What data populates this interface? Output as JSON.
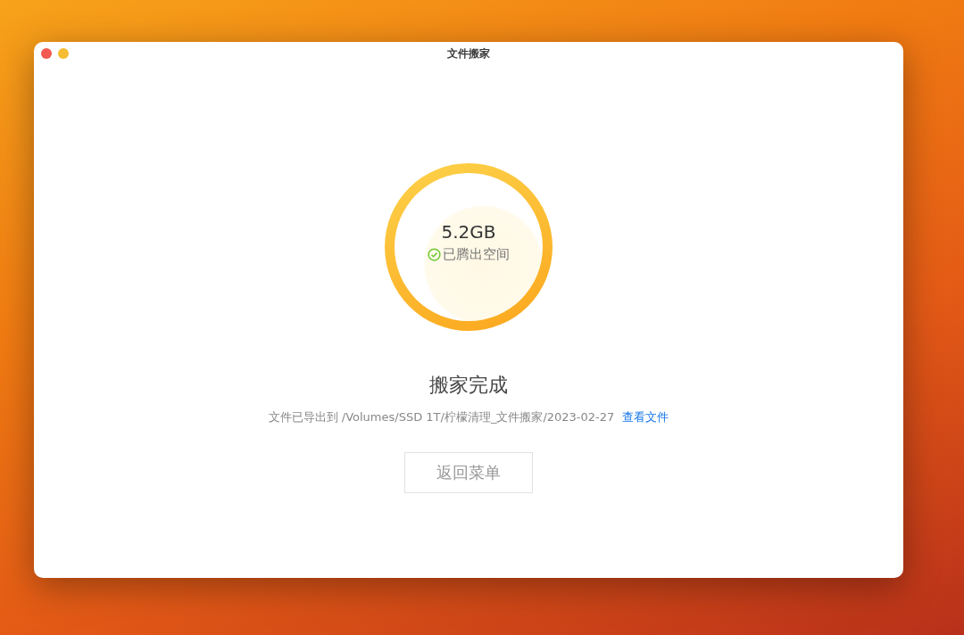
{
  "window": {
    "title": "文件搬家"
  },
  "ring": {
    "amount": "5.2GB",
    "status": "已腾出空间"
  },
  "result": {
    "heading": "搬家完成",
    "message": "文件已导出到 /Volumes/SSD 1T/柠檬清理_文件搬家/2023-02-27",
    "link": "查看文件"
  },
  "buttons": [
    "返回菜单"
  ]
}
